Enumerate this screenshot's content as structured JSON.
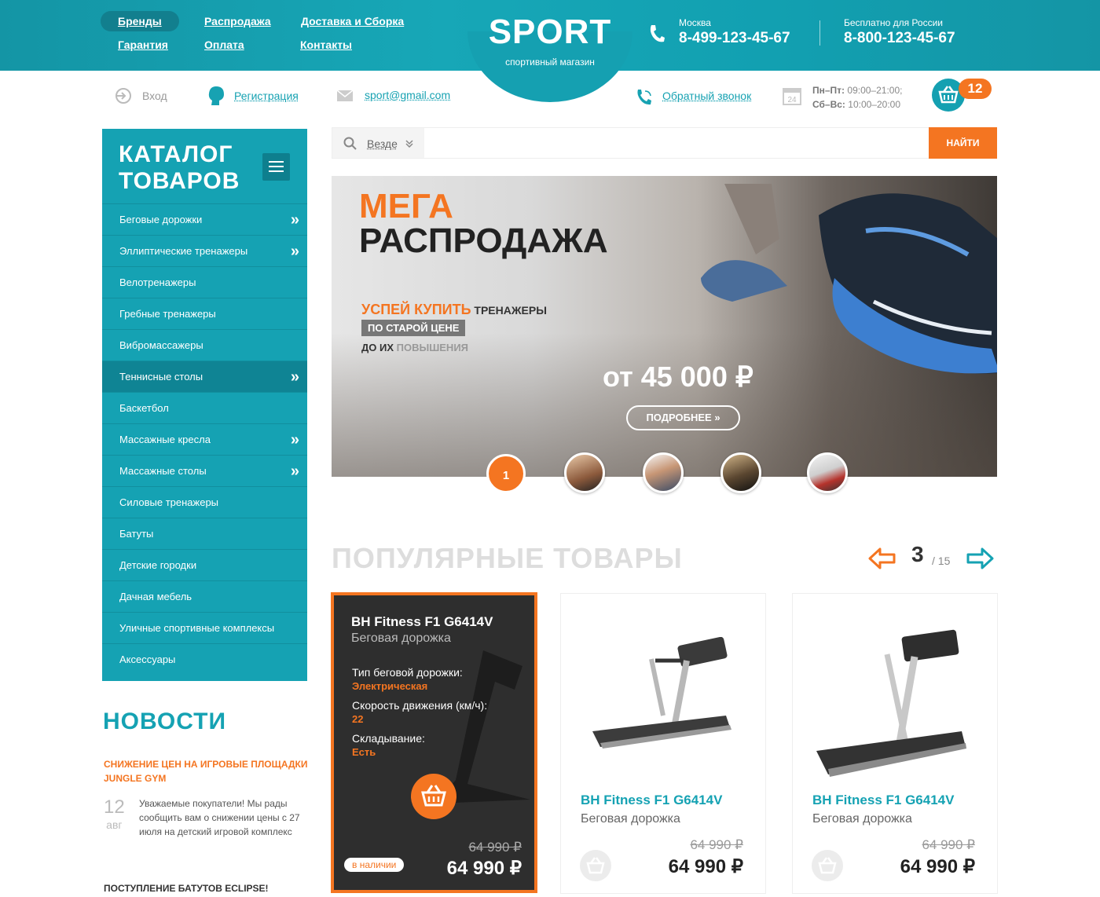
{
  "header": {
    "nav": [
      "Бренды",
      "Распродажа",
      "Доставка и Сборка",
      "Гарантия",
      "Оплата",
      "Контакты"
    ],
    "logo_title": "SPORT",
    "logo_subtitle": "спортивный магазин",
    "phones": [
      {
        "caption": "Москва",
        "number": "8-499-123-45-67"
      },
      {
        "caption": "Бесплатно для России",
        "number": "8-800-123-45-67"
      }
    ]
  },
  "subbar": {
    "login": "Вход",
    "register": "Регистрация",
    "email": "sport@gmail.com",
    "callback": "Обратный звонок",
    "hours_weekday_label": "Пн–Пт:",
    "hours_weekday": "09:00–21:00;",
    "hours_weekend_label": "Сб–Вс:",
    "hours_weekend": "10:00–20:00",
    "cart_count": "12"
  },
  "catalog": {
    "title_line1": "КАТАЛОГ",
    "title_line2": "ТОВАРОВ",
    "items": [
      {
        "label": "Беговые дорожки",
        "arrow": true
      },
      {
        "label": "Эллиптические тренажеры",
        "arrow": true
      },
      {
        "label": "Велотренажеры",
        "arrow": false
      },
      {
        "label": "Гребные тренажеры",
        "arrow": false
      },
      {
        "label": "Вибромассажеры",
        "arrow": false
      },
      {
        "label": "Теннисные столы",
        "arrow": true,
        "active": true
      },
      {
        "label": "Баскетбол",
        "arrow": false
      },
      {
        "label": "Массажные кресла",
        "arrow": true
      },
      {
        "label": "Массажные столы",
        "arrow": true
      },
      {
        "label": "Силовые тренажеры",
        "arrow": false
      },
      {
        "label": "Батуты",
        "arrow": false
      },
      {
        "label": "Детские городки",
        "arrow": false
      },
      {
        "label": "Дачная мебель",
        "arrow": false
      },
      {
        "label": "Уличные спортивные комплексы",
        "arrow": false
      },
      {
        "label": "Аксессуары",
        "arrow": false
      }
    ]
  },
  "news": {
    "title": "НОВОСТИ",
    "item1_title": "СНИЖЕНИЕ ЦЕН НА ИГРОВЫЕ ПЛОЩАДКИ JUNGLE GYM",
    "item1_day": "12",
    "item1_month": "авг",
    "item1_text": "Уважаемые покупатели! Мы рады сообщить вам о снижении цены с 27 июля на детский игровой комплекс",
    "item2_title": "ПОСТУПЛЕНИЕ БАТУТОВ ECLIPSE!"
  },
  "search": {
    "scope": "Везде",
    "placeholder": "",
    "button": "НАЙТИ"
  },
  "hero": {
    "mega": "МЕГА",
    "sale": "РАСПРОДАЖА",
    "line1_orange": "УСПЕЙ КУПИТЬ",
    "line1_dark": " ТРЕНАЖЕРЫ",
    "line2": "ПО СТАРОЙ ЦЕНЕ",
    "line3_dark": "ДО ИХ ",
    "line3_grey": "ПОВЫШЕНИЯ",
    "price": "от 45 000 ₽",
    "button": "ПОДРОБНЕЕ",
    "slide_current": "1"
  },
  "popular": {
    "title": "ПОПУЛЯРНЫЕ ТОВАРЫ",
    "page_current": "3",
    "page_total": "/ 15"
  },
  "products": [
    {
      "name": "BH Fitness F1 G6414V",
      "type": "Беговая дорожка",
      "spec1_label": "Тип беговой дорожки:",
      "spec1_value": "Электрическая",
      "spec2_label": "Скорость движения (км/ч):",
      "spec2_value": "22",
      "spec3_label": "Складывание:",
      "spec3_value": "Есть",
      "stock": "в наличии",
      "old_price": "64 990 ₽",
      "price": "64 990 ₽"
    },
    {
      "name": "BH Fitness F1 G6414V",
      "type": "Беговая дорожка",
      "old_price": "64 990 ₽",
      "price": "64 990 ₽"
    },
    {
      "name": "BH Fitness F1 G6414V",
      "type": "Беговая дорожка",
      "old_price": "64 990 ₽",
      "price": "64 990 ₽"
    }
  ],
  "colors": {
    "teal": "#15a2b3",
    "orange": "#f47521"
  }
}
